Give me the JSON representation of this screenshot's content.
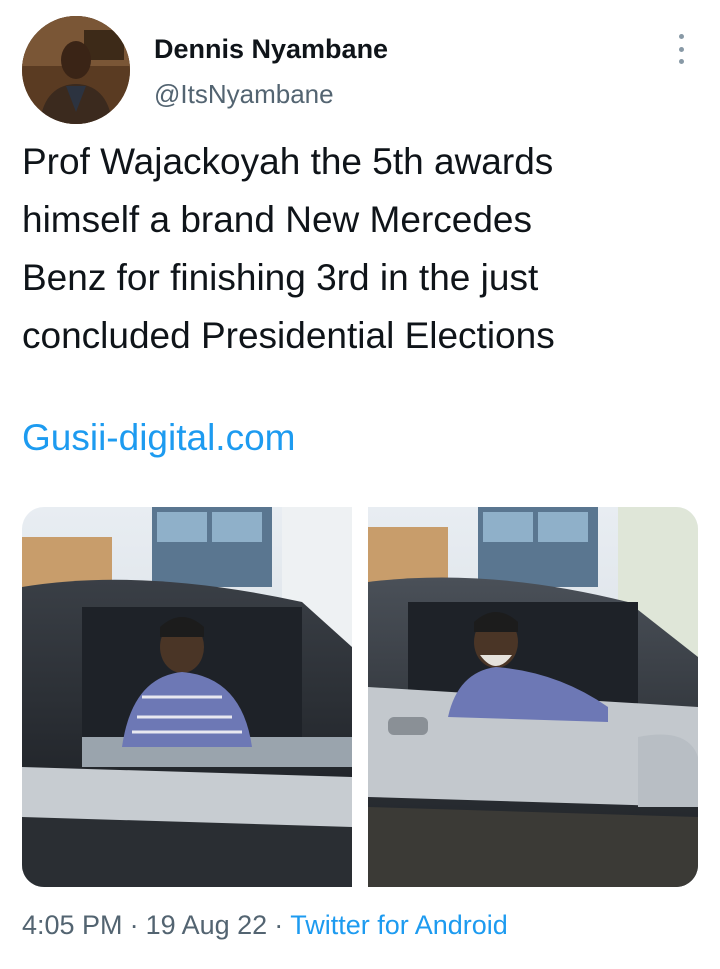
{
  "author": {
    "name": "Dennis Nyambane",
    "handle": "@ItsNyambane",
    "avatar_icon": "user-avatar-photo"
  },
  "tweet": {
    "text_lines": [
      "Prof Wajackoyah the 5th awards",
      "himself a brand New Mercedes",
      "Benz for finishing 3rd in the just",
      "concluded Presidential Elections"
    ],
    "link": "Gusii-digital.com"
  },
  "media": [
    {
      "description_icon": "photo-man-in-car-icon"
    },
    {
      "description_icon": "photo-man-in-car-icon"
    }
  ],
  "footer": {
    "time": "4:05 PM",
    "separator": "·",
    "date": "19 Aug 22",
    "source": "Twitter for Android"
  },
  "colors": {
    "link": "#1d9bf0",
    "secondary_text": "#536471",
    "primary_text": "#0f1419"
  }
}
